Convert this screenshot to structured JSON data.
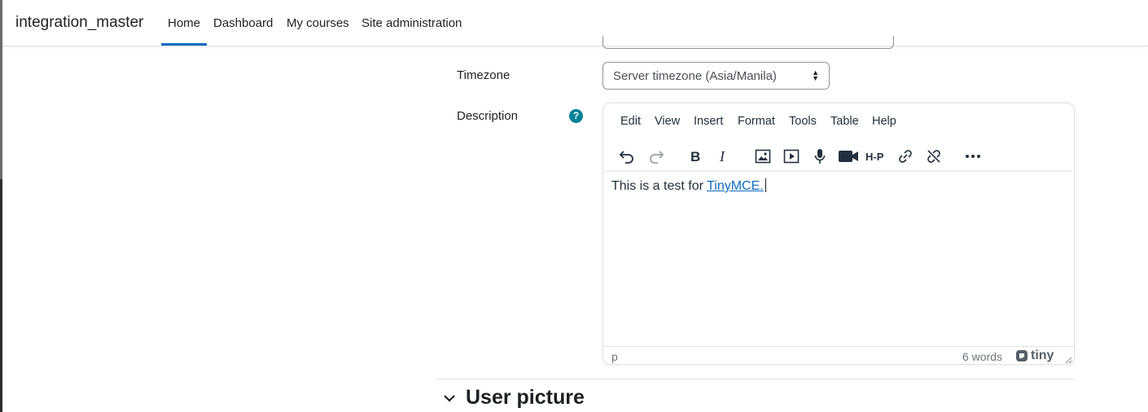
{
  "navbar": {
    "brand": "integration_master",
    "items": [
      {
        "label": "Home"
      },
      {
        "label": "Dashboard"
      },
      {
        "label": "My courses"
      },
      {
        "label": "Site administration"
      }
    ]
  },
  "form": {
    "timezone": {
      "label": "Timezone",
      "selected": "Server timezone (Asia/Manila)"
    },
    "description": {
      "label": "Description",
      "help_icon": "?"
    }
  },
  "editor": {
    "menu": [
      "Edit",
      "View",
      "Insert",
      "Format",
      "Tools",
      "Table",
      "Help"
    ],
    "toolbar_icons": [
      "undo-icon",
      "redo-icon",
      "bold-icon",
      "italic-icon",
      "image-icon",
      "media-icon",
      "microphone-icon",
      "video-camera-icon",
      "h5p-icon",
      "link-icon",
      "unlink-icon",
      "more-icon"
    ],
    "content_text": "This is a test for ",
    "content_link": "TinyMCE",
    "content_trailing": ".",
    "status_path": "p",
    "word_count": "6 words",
    "brand": "tiny"
  },
  "section": {
    "title": "User picture"
  },
  "colors": {
    "accent": "#0f6cbf",
    "help": "#008196",
    "text": "#1d2125"
  }
}
